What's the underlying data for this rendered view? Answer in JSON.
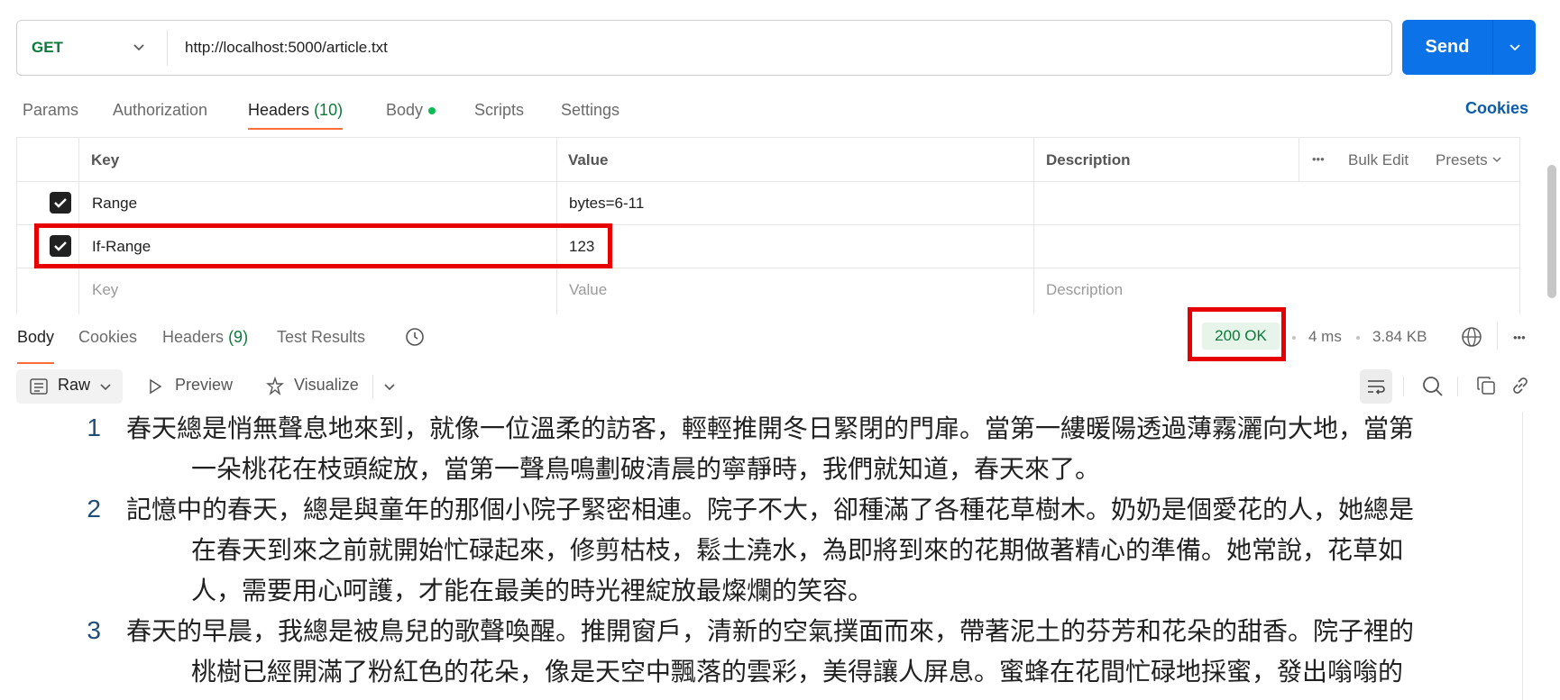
{
  "request": {
    "method": "GET",
    "url": "http://localhost:5000/article.txt",
    "send_label": "Send"
  },
  "request_tabs": {
    "params": "Params",
    "authorization": "Authorization",
    "headers": "Headers",
    "headers_count": "(10)",
    "body": "Body",
    "scripts": "Scripts",
    "settings": "Settings",
    "cookies": "Cookies"
  },
  "headers_table": {
    "columns": {
      "key": "Key",
      "value": "Value",
      "description": "Description"
    },
    "more": "•••",
    "bulk_edit": "Bulk Edit",
    "presets": "Presets",
    "rows": [
      {
        "checked": true,
        "key": "Range",
        "value": "bytes=6-11",
        "description": ""
      },
      {
        "checked": true,
        "key": "If-Range",
        "value": "123",
        "description": ""
      }
    ],
    "placeholder": {
      "key": "Key",
      "value": "Value",
      "description": "Description"
    }
  },
  "response": {
    "tabs": {
      "body": "Body",
      "cookies": "Cookies",
      "headers": "Headers",
      "headers_count": "(9)",
      "test_results": "Test Results"
    },
    "status": "200 OK",
    "time": "4 ms",
    "size": "3.84 KB",
    "more": "•••",
    "format": "Raw",
    "preview": "Preview",
    "visualize": "Visualize",
    "lines": [
      {
        "no": "1",
        "first": "春天總是悄無聲息地來到，就像一位溫柔的訪客，輕輕推開冬日緊閉的門扉。當第一縷暖陽透過薄霧灑向大地，當第",
        "rest": [
          "一朵桃花在枝頭綻放，當第一聲鳥鳴劃破清晨的寧靜時，我們就知道，春天來了。"
        ]
      },
      {
        "no": "2",
        "first": "記憶中的春天，總是與童年的那個小院子緊密相連。院子不大，卻種滿了各種花草樹木。奶奶是個愛花的人，她總是",
        "rest": [
          "在春天到來之前就開始忙碌起來，修剪枯枝，鬆土澆水，為即將到來的花期做著精心的準備。她常說，花草如",
          "人，需要用心呵護，才能在最美的時光裡綻放最燦爛的笑容。"
        ]
      },
      {
        "no": "3",
        "first": "春天的早晨，我總是被鳥兒的歌聲喚醒。推開窗戶，清新的空氣撲面而來，帶著泥土的芬芳和花朵的甜香。院子裡的",
        "rest": [
          "桃樹已經開滿了粉紅色的花朵，像是天空中飄落的雲彩，美得讓人屏息。蜜蜂在花間忙碌地採蜜，發出嗡嗡的"
        ]
      }
    ]
  },
  "colors": {
    "accent_orange": "#ff6c37",
    "send_blue": "#0b72e7",
    "method_green": "#0b7a3b",
    "highlight_red": "#e60000",
    "status_bg": "#e6f4ea"
  }
}
